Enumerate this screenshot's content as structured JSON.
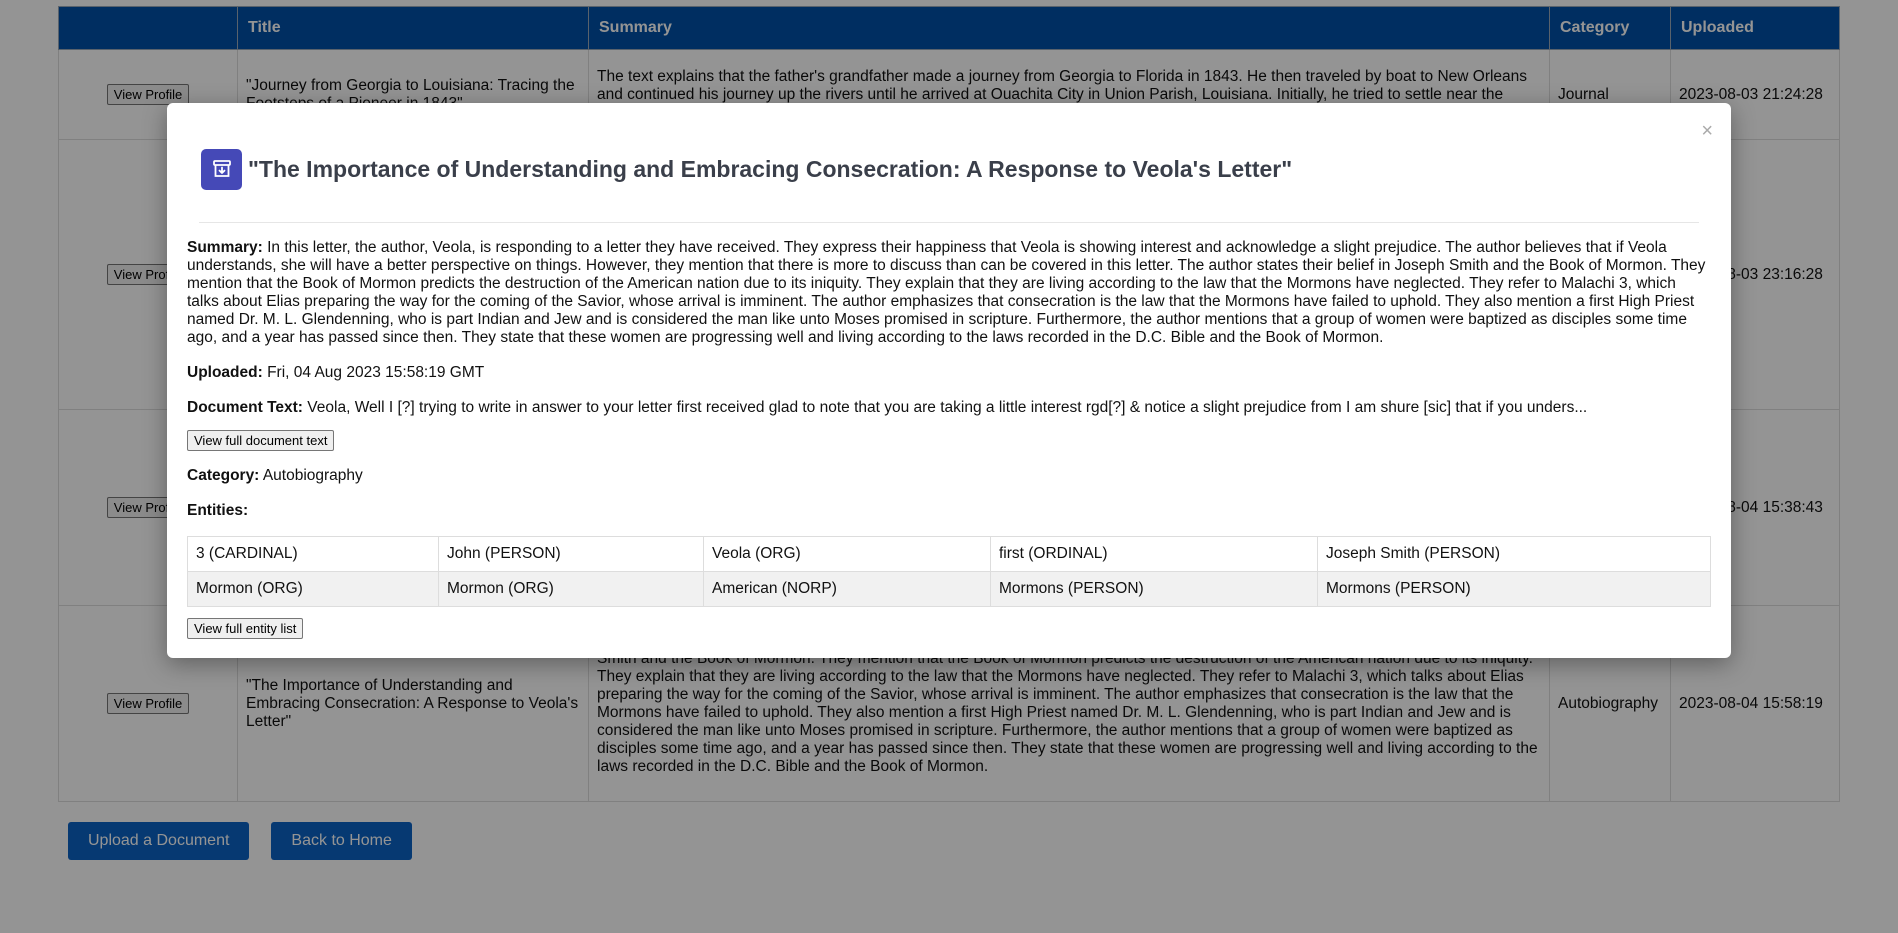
{
  "table": {
    "headers": [
      "",
      "Title",
      "Summary",
      "Category",
      "Uploaded"
    ],
    "rows": [
      {
        "button": "View Profile",
        "title": "\"Journey from Georgia to Louisiana: Tracing the Footsteps of a Pioneer in 1843\"",
        "summary": "The text explains that the father's grandfather made a journey from Georgia to Florida in 1843. He then traveled by boat to New Orleans and continued his journey up the rivers until he arrived at Ouachita City in Union Parish, Louisiana. Initially, he tried to settle near the Louter, near the Arkansas border, but was unable to do so due to a lack of funds for homesteading. Consequently, he had to",
        "category": "Journal",
        "uploaded": "2023-08-03 21:24:28"
      },
      {
        "button": "View Profile",
        "title": "",
        "summary": "",
        "category": "",
        "uploaded": "2023-08-03 23:16:28"
      },
      {
        "button": "View Profile",
        "title": "",
        "summary": "",
        "category": "",
        "uploaded": "2023-08-04 15:38:43"
      },
      {
        "button": "View Profile",
        "title": "\"The Importance of Understanding and Embracing Consecration: A Response to Veola's Letter\"",
        "summary": "things. However, they mention that there is more to discuss than can be covered in this letter. The author states their belief in Joseph Smith and the Book of Mormon. They mention that the Book of Mormon predicts the destruction of the American nation due to its iniquity. They explain that they are living according to the law that the Mormons have neglected. They refer to Malachi 3, which talks about Elias preparing the way for the coming of the Savior, whose arrival is imminent. The author emphasizes that consecration is the law that the Mormons have failed to uphold. They also mention a first High Priest named Dr. M. L. Glendenning, who is part Indian and Jew and is considered the man like unto Moses promised in scripture. Furthermore, the author mentions that a group of women were baptized as disciples some time ago, and a year has passed since then. They state that these women are progressing well and living according to the laws recorded in the D.C. Bible and the Book of Mormon.",
        "category": "Autobiography",
        "uploaded": "2023-08-04 15:58:19"
      }
    ]
  },
  "actions": {
    "upload": "Upload a Document",
    "back": "Back to Home"
  },
  "modal": {
    "close": "×",
    "icon": "download-box-icon",
    "title": "\"The Importance of Understanding and Embracing Consecration: A Response to Veola's Letter\"",
    "summary_label": "Summary:",
    "summary": "In this letter, the author, Veola, is responding to a letter they have received. They express their happiness that Veola is showing interest and acknowledge a slight prejudice. The author believes that if Veola understands, she will have a better perspective on things. However, they mention that there is more to discuss than can be covered in this letter. The author states their belief in Joseph Smith and the Book of Mormon. They mention that the Book of Mormon predicts the destruction of the American nation due to its iniquity. They explain that they are living according to the law that the Mormons have neglected. They refer to Malachi 3, which talks about Elias preparing the way for the coming of the Savior, whose arrival is imminent. The author emphasizes that consecration is the law that the Mormons have failed to uphold. They also mention a first High Priest named Dr. M. L. Glendenning, who is part Indian and Jew and is considered the man like unto Moses promised in scripture. Furthermore, the author mentions that a group of women were baptized as disciples some time ago, and a year has passed since then. They state that these women are progressing well and living according to the laws recorded in the D.C. Bible and the Book of Mormon.",
    "uploaded_label": "Uploaded:",
    "uploaded": "Fri, 04 Aug 2023 15:58:19 GMT",
    "doc_text_label": "Document Text:",
    "doc_text": "Veola, Well I [?] trying to write in answer to your letter first received glad to note that you are taking a little interest rgd[?] & notice a slight prejudice from I am shure [sic] that if you unders...",
    "view_full_text": "View full document text",
    "category_label": "Category:",
    "category": "Autobiography",
    "entities_label": "Entities:",
    "entities": [
      [
        "3 (CARDINAL)",
        "John (PERSON)",
        "Veola (ORG)",
        "first (ORDINAL)",
        "Joseph Smith (PERSON)"
      ],
      [
        "Mormon (ORG)",
        "Mormon (ORG)",
        "American (NORP)",
        "Mormons (PERSON)",
        "Mormons (PERSON)"
      ]
    ],
    "view_full_entities": "View full entity list"
  }
}
